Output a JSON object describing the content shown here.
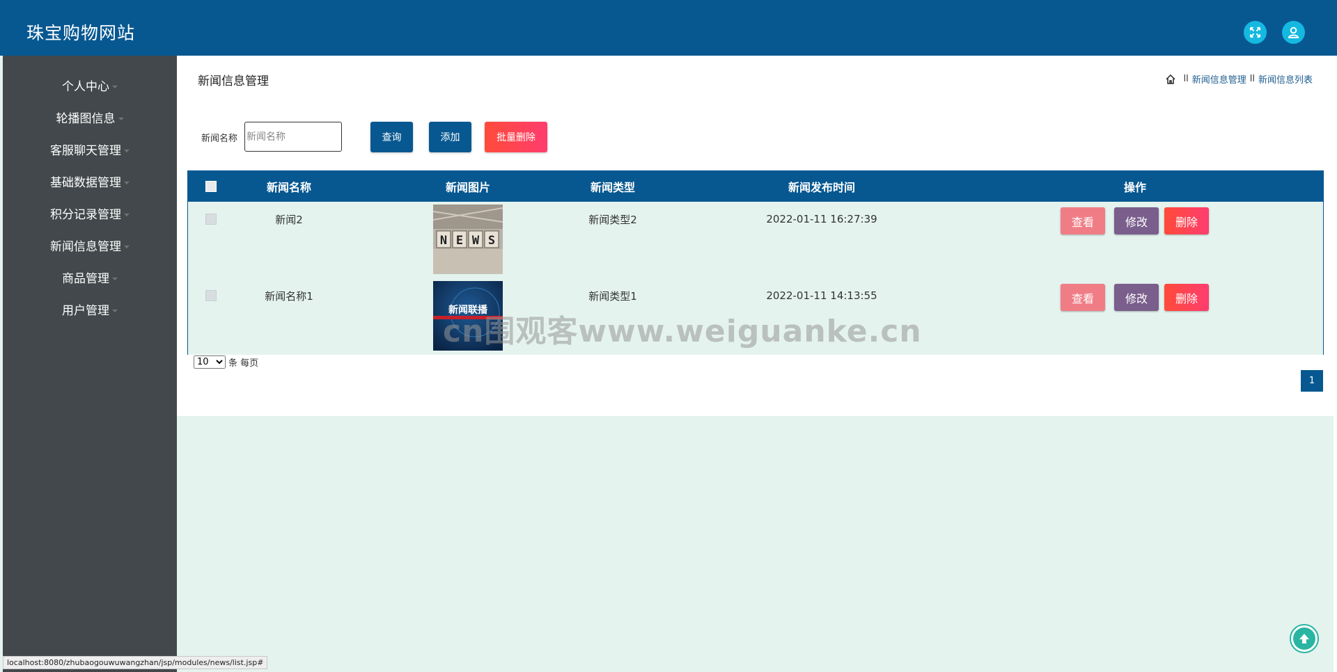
{
  "header": {
    "brand": "珠宝购物网站",
    "expand_icon": "fullscreen-icon",
    "user_icon": "user-icon",
    "accent_color": "#075891"
  },
  "sidebar": {
    "items": [
      {
        "label": "个人中心"
      },
      {
        "label": "轮播图信息"
      },
      {
        "label": "客服聊天管理"
      },
      {
        "label": "基础数据管理"
      },
      {
        "label": "积分记录管理"
      },
      {
        "label": "新闻信息管理"
      },
      {
        "label": "商品管理"
      },
      {
        "label": "用户管理"
      }
    ]
  },
  "page": {
    "title": "新闻信息管理",
    "breadcrumb": [
      "新闻信息管理",
      "新闻信息列表"
    ],
    "breadcrumb_sep": "ll"
  },
  "search": {
    "label": "新闻名称",
    "placeholder": "新闻名称",
    "value": "",
    "query_label": "查询",
    "add_label": "添加",
    "batch_delete_label": "批量删除"
  },
  "table": {
    "columns": [
      "新闻名称",
      "新闻图片",
      "新闻类型",
      "新闻发布时间",
      "操作"
    ],
    "rows": [
      {
        "name": "新闻2",
        "image": "NEWS",
        "type": "新闻类型2",
        "time": "2022-01-11 16:27:39"
      },
      {
        "name": "新闻名称1",
        "image": "新闻联播",
        "type": "新闻类型1",
        "time": "2022-01-11 14:13:55"
      }
    ],
    "actions": {
      "view": "查看",
      "edit": "修改",
      "delete": "删除"
    }
  },
  "pagination": {
    "page_size": "10",
    "page_size_options": [
      "10"
    ],
    "per_page_label": "条 每页",
    "current_page": "1"
  },
  "watermark": "cn围观客www.weiguanke.cn",
  "status_bar": "localhost:8080/zhubaogouwuwangzhan/jsp/modules/news/list.jsp#"
}
